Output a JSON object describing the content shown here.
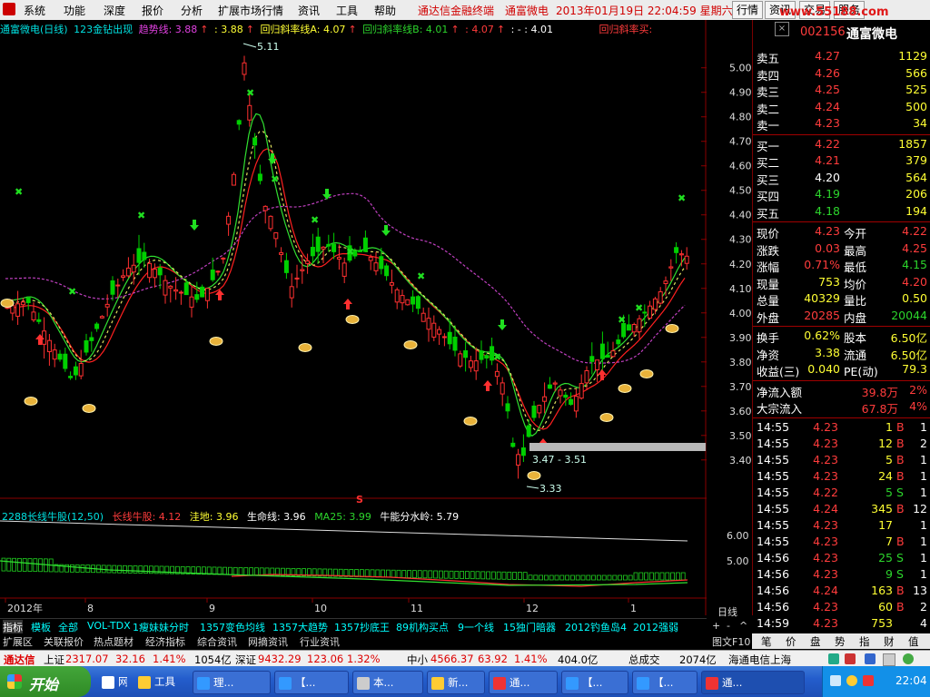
{
  "menu": {
    "items": [
      "系统",
      "功能",
      "深度",
      "报价",
      "分析",
      "扩展市场行情",
      "资讯",
      "工具",
      "帮助"
    ],
    "app_name": "通达信金融终端",
    "stock_name": "通富微电",
    "datetime": "2013年01月19日 22:04:59 星期六",
    "right_buttons": [
      "行情",
      "资讯",
      "交易",
      "服务"
    ],
    "watermark": "www.55188.com"
  },
  "chart": {
    "header": {
      "title": "通富微电(日线)",
      "indicator": "123金钻出现",
      "trend_label": "趋势线: 3.88",
      "trend_val2": ": 3.88",
      "regA_label": "回归斜率线A: 4.07",
      "regB_label": "回归斜率线B: 4.01",
      "regB_val2": ": 4.07",
      "regB_val3": ": - : 4.01",
      "buy_label": "回归斜率买:"
    },
    "max_price_label": "5.11",
    "min_price_label": "3.33",
    "range_label": "3.47 - 3.51",
    "s_marker": "S",
    "sub_header": {
      "title": "2288长线牛股(12,50)",
      "long_bull": "长线牛股: 4.12",
      "ground": "洼地: 3.96",
      "life_line": "生命线: 3.96",
      "ma25": "MA25: 3.99",
      "watershed": "牛能分水岭: 5.79"
    },
    "sub_axis": [
      "6.00",
      "5.00"
    ],
    "x_labels": [
      {
        "label": "2012年",
        "x": 4
      },
      {
        "label": "8",
        "x": 92
      },
      {
        "label": "9",
        "x": 226
      },
      {
        "label": "10",
        "x": 342
      },
      {
        "label": "11",
        "x": 448
      },
      {
        "label": "12",
        "x": 575
      },
      {
        "label": "1",
        "x": 690
      }
    ],
    "period_label": "日线"
  },
  "chart_data": {
    "type": "candlestick",
    "y_ticks": [
      "5.00",
      "4.90",
      "4.80",
      "4.70",
      "4.60",
      "4.50",
      "4.40",
      "4.30",
      "4.20",
      "4.10",
      "4.00",
      "3.90",
      "3.80",
      "3.70",
      "3.60",
      "3.50",
      "3.40"
    ],
    "ylim": [
      3.34,
      5.11
    ]
  },
  "quote": {
    "code": "002156",
    "name": "通富微电",
    "sells": [
      {
        "label": "卖五",
        "price": "4.27",
        "vol": "1129"
      },
      {
        "label": "卖四",
        "price": "4.26",
        "vol": "566"
      },
      {
        "label": "卖三",
        "price": "4.25",
        "vol": "525"
      },
      {
        "label": "卖二",
        "price": "4.24",
        "vol": "500"
      },
      {
        "label": "卖一",
        "price": "4.23",
        "vol": "34"
      }
    ],
    "buys": [
      {
        "label": "买一",
        "price": "4.22",
        "vol": "1857"
      },
      {
        "label": "买二",
        "price": "4.21",
        "vol": "379"
      },
      {
        "label": "买三",
        "price": "4.20",
        "vol": "564"
      },
      {
        "label": "买四",
        "price": "4.19",
        "vol": "206"
      },
      {
        "label": "买五",
        "price": "4.18",
        "vol": "194"
      }
    ],
    "stats": [
      {
        "l1": "现价",
        "v1": "4.23",
        "l2": "今开",
        "v2": "4.22"
      },
      {
        "l1": "涨跌",
        "v1": "0.03",
        "l2": "最高",
        "v2": "4.25"
      },
      {
        "l1": "涨幅",
        "v1": "0.71%",
        "l2": "最低",
        "v2": "4.15"
      },
      {
        "l1": "现量",
        "v1": "753",
        "l2": "均价",
        "v2": "4.20"
      },
      {
        "l1": "总量",
        "v1": "40329",
        "l2": "量比",
        "v2": "0.50"
      },
      {
        "l1": "外盘",
        "v1": "20285",
        "l2": "内盘",
        "v2": "20044"
      }
    ],
    "stats2": [
      {
        "l1": "换手",
        "v1": "0.62%",
        "l2": "股本",
        "v2": "6.50亿"
      },
      {
        "l1": "净资",
        "v1": "3.38",
        "l2": "流通",
        "v2": "6.50亿"
      },
      {
        "l1": "收益(三)",
        "v1": "0.040",
        "l2": "PE(动)",
        "v2": "79.3"
      }
    ],
    "flows": [
      {
        "label": "净流入额",
        "v": "39.8万",
        "p": "2%"
      },
      {
        "label": "大宗流入",
        "v": "67.8万",
        "p": "4%"
      }
    ],
    "ticks": [
      {
        "t": "14:55",
        "p": "4.23",
        "v": "1",
        "d": "B",
        "n": "1"
      },
      {
        "t": "14:55",
        "p": "4.23",
        "v": "12",
        "d": "B",
        "n": "2"
      },
      {
        "t": "14:55",
        "p": "4.23",
        "v": "5",
        "d": "B",
        "n": "1"
      },
      {
        "t": "14:55",
        "p": "4.23",
        "v": "24",
        "d": "B",
        "n": "1"
      },
      {
        "t": "14:55",
        "p": "4.22",
        "v": "5",
        "d": "S",
        "n": "1"
      },
      {
        "t": "14:55",
        "p": "4.24",
        "v": "345",
        "d": "B",
        "n": "12"
      },
      {
        "t": "14:55",
        "p": "4.23",
        "v": "17",
        "d": "",
        "n": "1"
      },
      {
        "t": "14:55",
        "p": "4.23",
        "v": "7",
        "d": "B",
        "n": "1"
      },
      {
        "t": "14:56",
        "p": "4.23",
        "v": "25",
        "d": "S",
        "n": "1"
      },
      {
        "t": "14:56",
        "p": "4.23",
        "v": "9",
        "d": "S",
        "n": "1"
      },
      {
        "t": "14:56",
        "p": "4.24",
        "v": "163",
        "d": "B",
        "n": "13"
      },
      {
        "t": "14:56",
        "p": "4.23",
        "v": "60",
        "d": "B",
        "n": "2"
      },
      {
        "t": "14:59",
        "p": "4.23",
        "v": "753",
        "d": "",
        "n": "4"
      }
    ]
  },
  "tabs1": [
    "指标",
    "模板",
    "全部",
    "VOL-TDX",
    "1瘦妹妹分时",
    "1357变色均线",
    "1357大趋势",
    "1357抄底王",
    "89机构买点",
    "9一个线",
    "15独门暗器",
    "2012钓鱼岛4",
    "2012强弱"
  ],
  "tabs2": [
    "扩展区",
    "关联报价",
    "热点题材",
    "经济指标",
    "综合资讯",
    "网摘资讯",
    "行业资讯"
  ],
  "right_tabs": [
    "笔",
    "价",
    "盘",
    "势",
    "指",
    "财",
    "值"
  ],
  "right_top_tab": "图文F10",
  "status": {
    "brand": "通达信",
    "sh_label": "上证",
    "sh_val": "2317.07",
    "sh_chg": "32.16",
    "sh_pct": "1.41%",
    "sh_amt": "1054亿",
    "sz_label": "深证",
    "sz_val": "9432.29",
    "sz_chg": "123.06",
    "sz_pct": "1.32%",
    "zx_label": "中小",
    "zx_val": "4566.37",
    "zx_chg": "63.92",
    "zx_pct": "1.41%",
    "zx_amt": "404.0亿",
    "total_label": "总成交",
    "total_val": "2074亿",
    "server": "海通电信上海"
  },
  "taskbar": {
    "start": "开始",
    "tasks": [
      "网络",
      "工具",
      "理...",
      "【...",
      "本...",
      "新...",
      "通...",
      "【...",
      "【...",
      "通..."
    ],
    "clock": "22:04"
  }
}
